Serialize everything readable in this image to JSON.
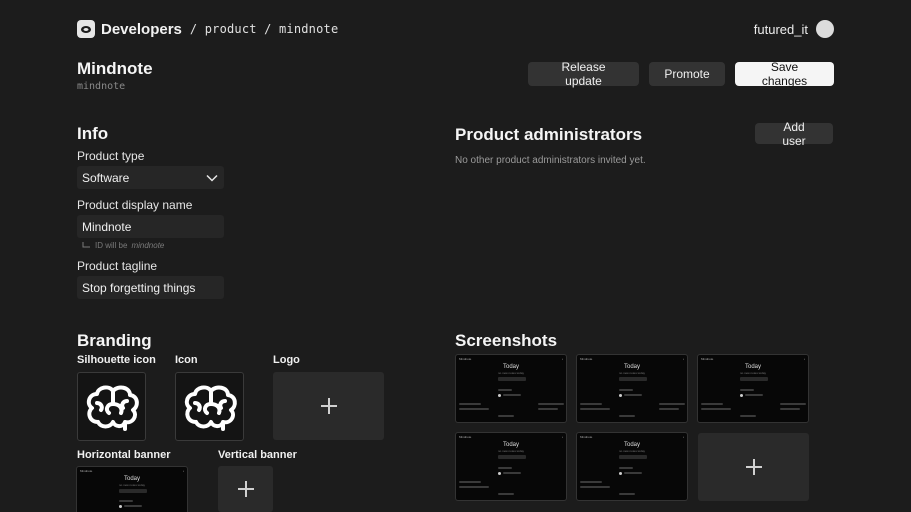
{
  "topbar": {
    "brand": "Developers",
    "breadcrumb": "/ product / mindnote",
    "username": "futured_it"
  },
  "header": {
    "title": "Mindnote",
    "slug": "mindnote",
    "buttons": {
      "release": "Release update",
      "promote": "Promote",
      "save": "Save changes"
    }
  },
  "info": {
    "heading": "Info",
    "product_type_label": "Product type",
    "product_type_value": "Software",
    "display_name_label": "Product display name",
    "display_name_value": "Mindnote",
    "id_hint_prefix": "ID will be",
    "id_hint_value": "mindnote",
    "tagline_label": "Product tagline",
    "tagline_value": "Stop forgetting things"
  },
  "admins": {
    "heading": "Product administrators",
    "add_user": "Add user",
    "empty_note": "No other product administrators invited yet."
  },
  "branding": {
    "heading": "Branding",
    "silhouette_label": "Silhouette icon",
    "icon_label": "Icon",
    "logo_label": "Logo",
    "horizontal_label": "Horizontal banner",
    "vertical_label": "Vertical banner"
  },
  "screenshots": {
    "heading": "Screenshots",
    "preview": {
      "app_name": "Mindnote",
      "title": "Today",
      "subtitle": "no new notes today"
    }
  },
  "colors": {
    "background": "#1c1c1c",
    "surface": "#262626",
    "button": "#333333",
    "primary_button": "#f5f5f5"
  }
}
